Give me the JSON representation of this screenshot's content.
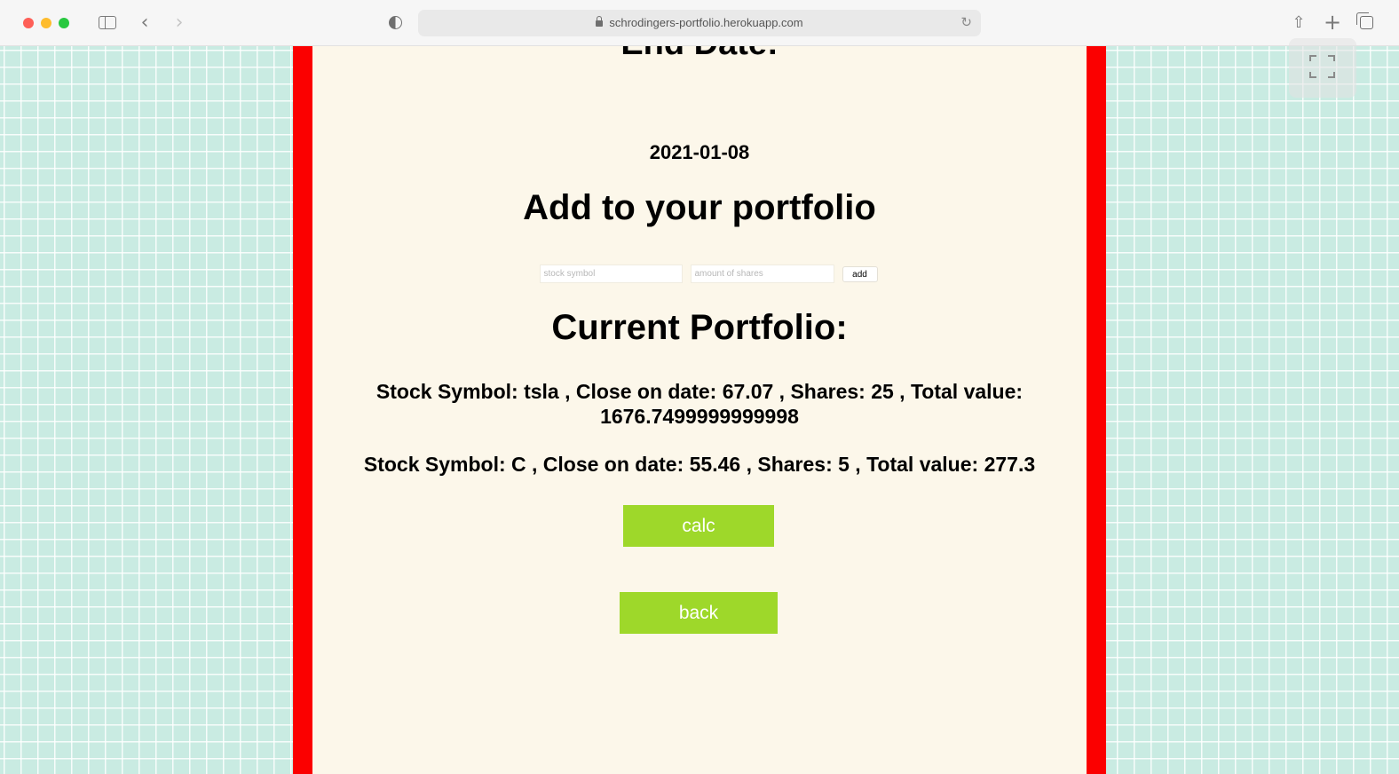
{
  "browser": {
    "url": "schrodingers-portfolio.herokuapp.com",
    "icons": [
      "sidebar-icon",
      "back-icon",
      "forward-icon",
      "shield-icon",
      "lock-icon",
      "reload-icon",
      "share-icon",
      "new-tab-icon",
      "tabs-overview-icon"
    ],
    "glyphs": {
      "back": "‹",
      "forward": "›",
      "reload": "↻",
      "share": "⇧",
      "new_tab": "+"
    }
  },
  "page": {
    "end_date_heading": "End Date:",
    "end_date_value": "2021-01-08",
    "add_heading": "Add to your portfolio",
    "form": {
      "symbol_placeholder": "stock symbol",
      "shares_placeholder": "amount of shares",
      "add_label": "add"
    },
    "portfolio_heading": "Current Portfolio:",
    "stocks": [
      {
        "text": "Stock Symbol: tsla , Close on date: 67.07 , Shares: 25 , Total value: 1676.7499999999998"
      },
      {
        "text": "Stock Symbol: C , Close on date: 55.46 , Shares: 5 , Total value: 277.3"
      }
    ],
    "calc_label": "calc",
    "back_label": "back"
  },
  "colors": {
    "panel_border": "#fb0000",
    "panel_bg": "#fcf7ea",
    "button_green": "#9ed82a",
    "page_bg": "#c9ebe2"
  }
}
